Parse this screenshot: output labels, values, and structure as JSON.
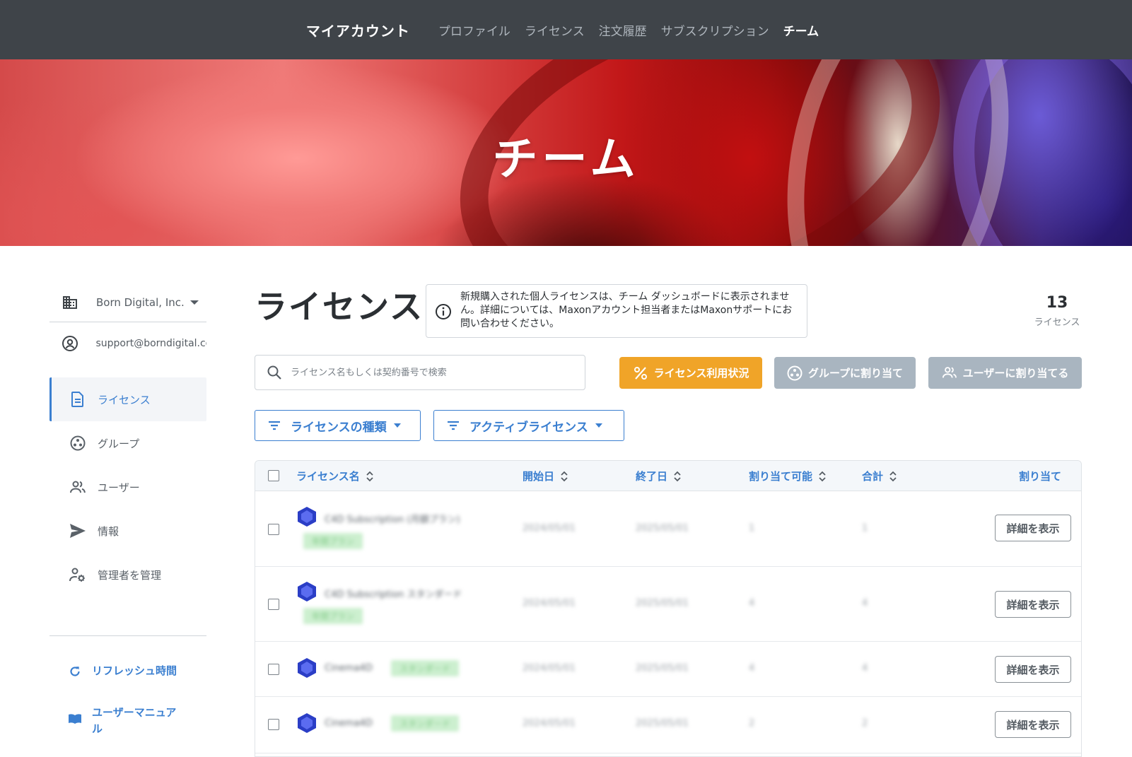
{
  "topnav": {
    "brand": "マイアカウント",
    "items": [
      "プロファイル",
      "ライセンス",
      "注文履歴",
      "サブスクリプション",
      "チーム"
    ],
    "active": "チーム"
  },
  "hero": {
    "title": "チーム"
  },
  "sidebar": {
    "org": "Born Digital, Inc.",
    "account": "support@borndigital.co",
    "menu": [
      {
        "label": "ライセンス",
        "icon": "document-icon",
        "active": true
      },
      {
        "label": "グループ",
        "icon": "group-icon",
        "active": false
      },
      {
        "label": "ユーザー",
        "icon": "users-icon",
        "active": false
      },
      {
        "label": "情報",
        "icon": "send-icon",
        "active": false
      },
      {
        "label": "管理者を管理",
        "icon": "admin-settings-icon",
        "active": false
      }
    ],
    "refresh_label": "リフレッシュ時間",
    "manual_label_1": "ユーザーマニュア",
    "manual_label_2": "ル"
  },
  "main": {
    "title": "ライセンス",
    "notice": "新規購入された個人ライセンスは、チーム ダッシュボードに表示されません。詳細については、Maxonアカウント担当者またはMaxonサポートにお問い合わせください。",
    "count_value": "13",
    "count_unit": "ライセンス",
    "search_placeholder": "ライセンス名もしくは契約番号で検索",
    "buttons": {
      "usage": "ライセンス利用状況",
      "assign_group": "グループに割り当て",
      "assign_user": "ユーザーに割り当てる"
    },
    "filters": {
      "type": "ライセンスの種類",
      "active": "アクティブライセンス"
    }
  },
  "table": {
    "columns": [
      "ライセンス名",
      "開始日",
      "終了日",
      "割り当て可能",
      "合計",
      "割り当て"
    ],
    "detail_label": "詳細を表示",
    "rows": [
      {
        "name": "C4D Subscription (月額プラン)",
        "tag": "年間プラン",
        "start": "2024/05/01",
        "end": "2025/05/01",
        "assignable": "1",
        "total": "1"
      },
      {
        "name": "C4D Subscription スタンダード",
        "tag": "年間プラン",
        "start": "2024/05/01",
        "end": "2025/05/01",
        "assignable": "4",
        "total": "4"
      },
      {
        "name": "Cinema4D",
        "tag": "スタンダード",
        "start": "2024/05/01",
        "end": "2025/05/01",
        "assignable": "4",
        "total": "4"
      },
      {
        "name": "Cinema4D",
        "tag": "スタンダード",
        "start": "2024/05/01",
        "end": "2025/05/01",
        "assignable": "2",
        "total": "2"
      }
    ]
  },
  "colors": {
    "nav_bg": "#3f4449",
    "accent_blue": "#3b7fd0",
    "usage_orange": "#f0a428",
    "disabled_gray": "#a9b5c0"
  }
}
